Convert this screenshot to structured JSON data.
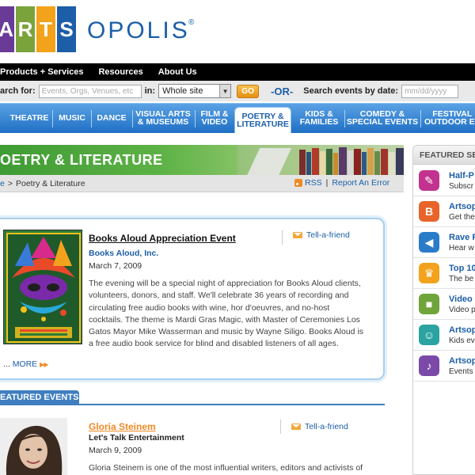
{
  "logo": {
    "letters": [
      "A",
      "R",
      "T",
      "S"
    ],
    "rest": "OPOLIS",
    "reg": "®"
  },
  "topnav": {
    "items": [
      "Products + Services",
      "Resources",
      "About Us"
    ]
  },
  "search": {
    "label": "arch for:",
    "placeholder": "Events, Orgs, Venues, etc",
    "in_label": "in:",
    "scope": "Whole site",
    "go": "GO",
    "or": "-OR-",
    "date_label": "Search events by date:",
    "date_placeholder": "mm/dd/yyyy"
  },
  "categories": [
    {
      "label": "THEATRE"
    },
    {
      "label": "MUSIC"
    },
    {
      "label": "DANCE"
    },
    {
      "label": "VISUAL ARTS\n& MUSEUMS"
    },
    {
      "label": "FILM &\nVIDEO"
    },
    {
      "label": "POETRY &\nLITERATURE",
      "active": true
    },
    {
      "label": "KIDS &\nFAMILIES"
    },
    {
      "label": "COMEDY &\nSPECIAL EVENTS"
    },
    {
      "label": "FESTIVAL\nOUTDOOR EV"
    }
  ],
  "page": {
    "title": "OETRY & LITERATURE"
  },
  "breadcrumb": {
    "home": "e",
    "separator": ">",
    "current": "Poetry & Literature",
    "rss": "RSS",
    "divider": "|",
    "report": "Report An Error"
  },
  "featured": {
    "title": "Books Aloud Appreciation Event",
    "org": "Books Aloud, Inc.",
    "date": "March 7, 2009",
    "description": "The evening will be a special night of appreciation for Books Aloud clients, volunteers, donors, and staff. We'll celebrate 36 years of recording and circulating free audio books with wine, hor d'oeuvres, and no-host cocktails. The  theme is Mardi Gras Magic, with Master of Ceremonies Los Gatos Mayor Mike Wasserman and music by Wayne Siligo. Books Aloud is a free audio book service for blind and disabled listeners of all ages.",
    "more_prefix": "...",
    "more": "MORE",
    "tell": "Tell-a-friend"
  },
  "featured_events": {
    "heading": "EATURED EVENTS",
    "event": {
      "title": "Gloria Steinem",
      "subtitle": "Let's Talk Entertainment",
      "date": "March 9, 2009",
      "description": "Gloria Steinem is one of the most influential writers, editors and activists of",
      "tell": "Tell-a-friend"
    }
  },
  "sidebar": {
    "heading": "FEATURED SE",
    "items": [
      {
        "title": "Half-P",
        "sub": "Subscr",
        "color": "#c2338f",
        "icon": "ticket-icon"
      },
      {
        "title": "Artsop",
        "sub": "Get the",
        "color": "#e8642a",
        "icon": "blog-icon"
      },
      {
        "title": "Rave R",
        "sub": "Hear w",
        "color": "#2b7cc8",
        "icon": "megaphone-icon"
      },
      {
        "title": "Top 10",
        "sub": "The be",
        "color": "#f2a21c",
        "icon": "trophy-icon"
      },
      {
        "title": "Video",
        "sub": "Video p",
        "color": "#6fa53a",
        "icon": "camera-icon"
      },
      {
        "title": "Artsop",
        "sub": "Kids ev",
        "color": "#2aa3a1",
        "icon": "kids-icon"
      },
      {
        "title": "Artsop",
        "sub": "Events",
        "color": "#7b49a8",
        "icon": "music-icon"
      }
    ]
  }
}
